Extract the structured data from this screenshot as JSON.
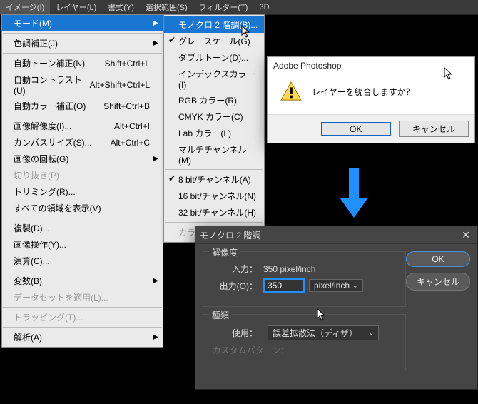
{
  "menubar": [
    "イメージ(I)",
    "レイヤー(L)",
    "書式(Y)",
    "選択範囲(S)",
    "フィルター(T)",
    "3D"
  ],
  "dropdown": {
    "mode": "モード(M)",
    "adjust": "色調補正(J)",
    "autoTone": "自動トーン補正(N)",
    "autoToneKey": "Shift+Ctrl+L",
    "autoContrast": "自動コントラスト(U)",
    "autoContrastKey": "Alt+Shift+Ctrl+L",
    "autoColor": "自動カラー補正(O)",
    "autoColorKey": "Shift+Ctrl+B",
    "imageSize": "画像解像度(I)...",
    "imageSizeKey": "Alt+Ctrl+I",
    "canvasSize": "カンバスサイズ(S)...",
    "canvasSizeKey": "Alt+Ctrl+C",
    "rotate": "画像の回転(G)",
    "crop": "切り抜き(P)",
    "trim": "トリミング(R)...",
    "revealAll": "すべての領域を表示(V)",
    "duplicate": "複製(D)...",
    "apply": "画像操作(Y)...",
    "calc": "演算(C)...",
    "vars": "変数(B)",
    "dataset": "データセットを適用(L)...",
    "trap": "トラッピング(T)...",
    "analysis": "解析(A)"
  },
  "submenu": {
    "bitmap": "モノクロ 2 階調(B)...",
    "grayscale": "グレースケール(G)",
    "duotone": "ダブルトーン(D)...",
    "indexed": "インデックスカラー(I)",
    "rgb": "RGB カラー(R)",
    "cmyk": "CMYK カラー(C)",
    "lab": "Lab カラー(L)",
    "multi": "マルチチャンネル(M)",
    "b8": "8 bit/チャンネル(A)",
    "b16": "16 bit/チャンネル(N)",
    "b32": "32 bit/チャンネル(H)",
    "colorTable": "カラーテーブル(T)..."
  },
  "msgbox": {
    "title": "Adobe Photoshop",
    "text": "レイヤーを統合しますか？",
    "ok": "OK",
    "cancel": "キャンセル"
  },
  "dialog": {
    "title": "モノクロ 2 階調",
    "resGroup": "解像度",
    "inputLbl": "入力：",
    "inputVal": "350 pixel/inch",
    "outputLbl": "出力(O)：",
    "outputVal": "350",
    "unit": "pixel/inch",
    "typeGroup": "種類",
    "useLbl": "使用：",
    "useVal": "誤差拡散法（ディザ）",
    "custom": "カスタムパターン：",
    "ok": "OK",
    "cancel": "キャンセル"
  }
}
